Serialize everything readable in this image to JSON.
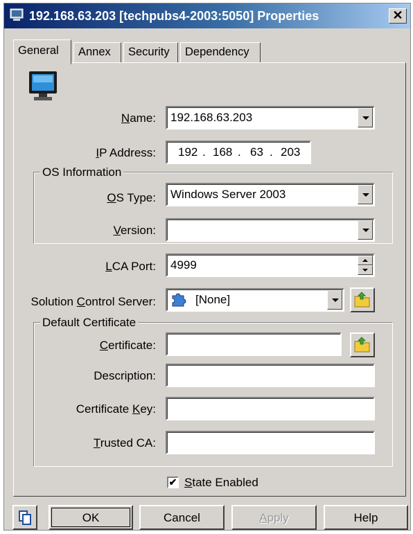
{
  "window": {
    "title": "192.168.63.203 [techpubs4-2003:5050] Properties",
    "close_label": "✕"
  },
  "tabs": [
    {
      "label": "General",
      "active": true
    },
    {
      "label": "Annex",
      "active": false
    },
    {
      "label": "Security",
      "active": false
    },
    {
      "label": "Dependency",
      "active": false
    }
  ],
  "general": {
    "object_icon": "monitor-icon",
    "name": {
      "label_pre": "",
      "label_u": "N",
      "label_post": "ame:",
      "value": "192.168.63.203"
    },
    "ip": {
      "label_pre": "",
      "label_u": "I",
      "label_post": "P Address:",
      "octets": [
        "192",
        "168",
        "63",
        "203"
      ],
      "separator": "."
    },
    "os_info": {
      "legend": "OS Information",
      "os_type": {
        "label_pre": "",
        "label_u": "O",
        "label_post": "S Type:",
        "value": "Windows Server 2003"
      },
      "version": {
        "label_pre": "",
        "label_u": "V",
        "label_post": "ersion:",
        "value": ""
      }
    },
    "lca_port": {
      "label_pre": "",
      "label_u": "L",
      "label_post": "CA Port:",
      "value": "4999"
    },
    "scs": {
      "label_pre": "Solution ",
      "label_u": "C",
      "label_post": "ontrol Server:",
      "value": "[None]",
      "icon": "puzzle-piece-icon"
    },
    "certificate": {
      "legend": "Default Certificate",
      "certificate": {
        "label_pre": "",
        "label_u": "C",
        "label_post": "ertificate:",
        "value": ""
      },
      "description": {
        "label": "Description:",
        "value": ""
      },
      "key": {
        "label_pre": "Certificate ",
        "label_u": "K",
        "label_post": "ey:",
        "value": ""
      },
      "trusted_ca": {
        "label_pre": "",
        "label_u": "T",
        "label_post": "rusted CA:",
        "value": ""
      }
    },
    "state_enabled": {
      "label_pre": "",
      "label_u": "S",
      "label_post": "tate Enabled",
      "checked": true,
      "check_mark": "✔"
    }
  },
  "buttons": {
    "ok": "OK",
    "cancel": "Cancel",
    "apply_u": "A",
    "apply_post": "pply",
    "help": "Help"
  },
  "colors": {
    "face": "#d6d3ce",
    "title_start": "#0a246a",
    "title_end": "#a6caf0"
  }
}
